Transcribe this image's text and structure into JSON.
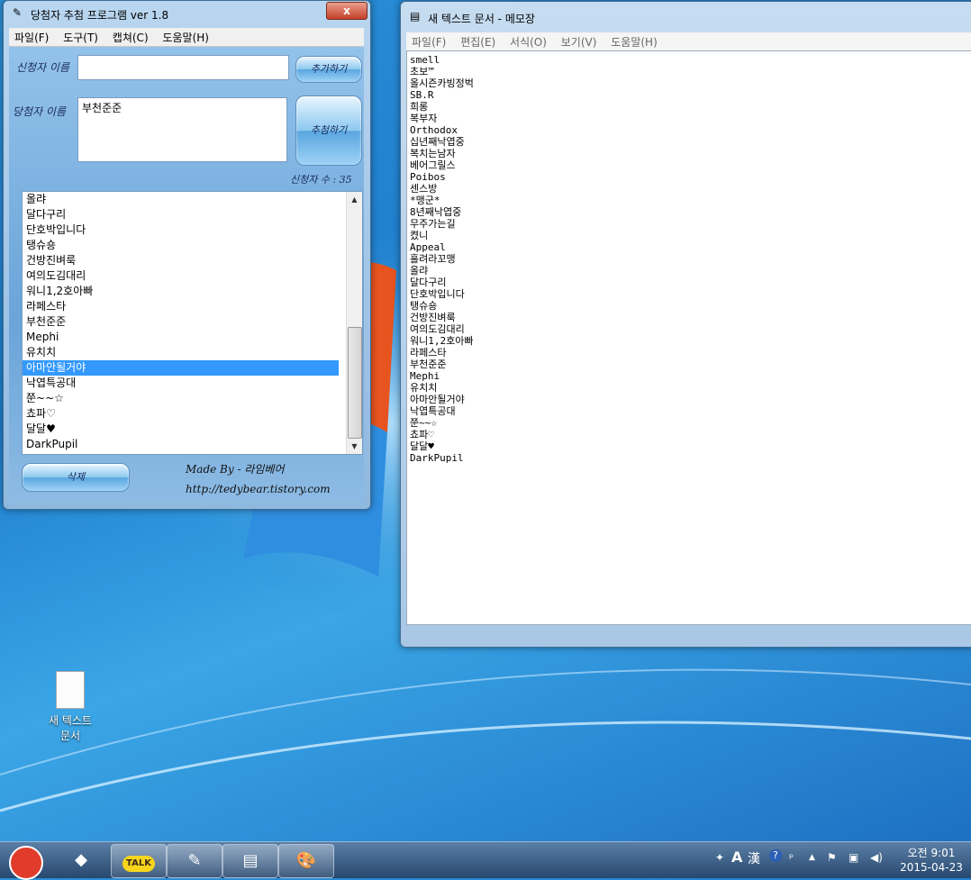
{
  "draw_window": {
    "title": "당첨자 추첨 프로그램 ver 1.8",
    "close": "x",
    "menu": [
      "파일(F)",
      "도구(T)",
      "캡쳐(C)",
      "도움말(H)"
    ],
    "applicant_label": "신청자 이름",
    "applicant_value": "",
    "add_button": "추가하기",
    "winner_label": "당첨자 이름",
    "winner_value": "부천준준",
    "draw_button": "추첨하기",
    "count_text": "신청자 수 : 35",
    "list_items": [
      "올랴",
      "달다구리",
      "단호박입니다",
      "탱슈숑",
      "건방진벼룩",
      "여의도김대리",
      "워니1,2호아빠",
      "라페스타",
      "부천준준",
      "Mephi",
      "유치치",
      "아마안될거야",
      "낙엽특공대",
      "쭌~~☆",
      "쵸파♡",
      "달달♥",
      "DarkPupil"
    ],
    "selected_index": 11,
    "delete_button": "삭제",
    "credit_line1": "Made By - 라임베어",
    "credit_line2": "http://tedybear.tistory.com"
  },
  "notepad": {
    "title": "새 텍스트 문서 - 메모장",
    "menu": [
      "파일(F)",
      "편집(E)",
      "서식(O)",
      "보기(V)",
      "도움말(H)"
    ],
    "lines": [
      "smell",
      "초보™",
      "올시즌카빙정벅",
      "SB.R",
      "희롱",
      "복부자",
      "Orthodox",
      "십년째낙엽중",
      "복치는남자",
      "베어그릴스",
      "Poibos",
      "센스방",
      "*맹군*",
      "8년째낙엽중",
      "무주가는길",
      "켰니",
      "Appeal",
      "흘려라꼬맹",
      "올랴",
      "달다구리",
      "단호박입니다",
      "탱슈숑",
      "건방진벼룩",
      "여의도김대리",
      "워니1,2호아빠",
      "라페스타",
      "부천준준",
      "Mephi",
      "유치치",
      "아마안될거야",
      "낙엽특공대",
      "쭌~~☆",
      "쵸파♡",
      "달달♥",
      "DarkPupil"
    ]
  },
  "desktop_icon": {
    "label_line1": "새 텍스트",
    "label_line2": "문서"
  },
  "taskbar": {
    "buttons": [
      "gom-icon",
      "explorer-icon",
      "kakaotalk-icon",
      "draw-program-icon",
      "notepad-icon",
      "paint-icon"
    ],
    "kakao_label": "TALK",
    "ime_a": "A",
    "ime_han": "漢",
    "help": "?",
    "time": "오전 9:01",
    "date": "2015-04-23"
  }
}
